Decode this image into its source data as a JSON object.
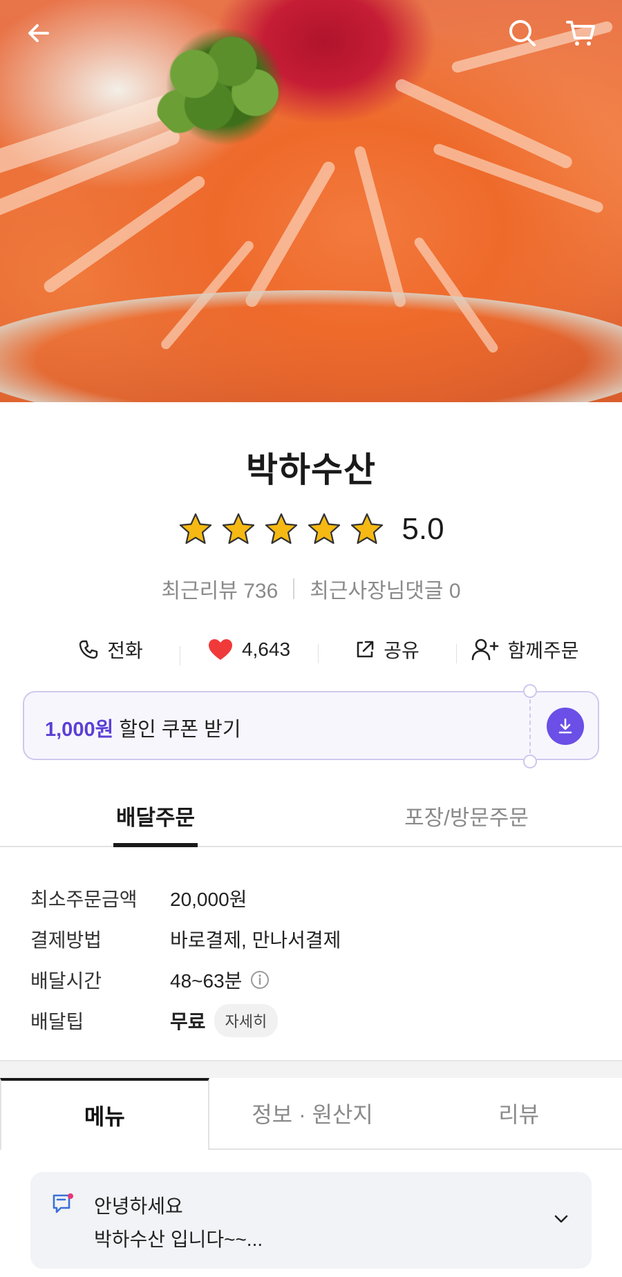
{
  "header": {
    "back_icon": "arrow-left-icon",
    "search_icon": "search-icon",
    "cart_icon": "cart-icon"
  },
  "store": {
    "name": "박하수산",
    "rating": "5.0",
    "stars": 5,
    "recent_reviews_label": "최근리뷰 736",
    "owner_replies_label": "최근사장님댓글 0"
  },
  "actions": {
    "call": "전화",
    "likes": "4,643",
    "share": "공유",
    "group_order": "함께주문"
  },
  "coupon": {
    "amount": "1,000원",
    "text": " 할인 쿠폰 받기"
  },
  "order_tabs": [
    "배달주문",
    "포장/방문주문"
  ],
  "info": {
    "min_order_label": "최소주문금액",
    "min_order_value": "20,000원",
    "payment_label": "결제방법",
    "payment_value": "바로결제, 만나서결제",
    "delivery_time_label": "배달시간",
    "delivery_time_value": "48~63분",
    "delivery_tip_label": "배달팁",
    "delivery_tip_value": "무료",
    "detail_button": "자세히"
  },
  "menu_tabs": [
    "메뉴",
    "정보 · 원산지",
    "리뷰"
  ],
  "notice": {
    "line1": "안녕하세요",
    "line2": "박하수산 입니다~~..."
  },
  "colors": {
    "accent_purple": "#6b4fe6",
    "coupon_amount": "#5b3fd6",
    "heart_red": "#f03a3a",
    "star_yellow": "#f6b913"
  }
}
